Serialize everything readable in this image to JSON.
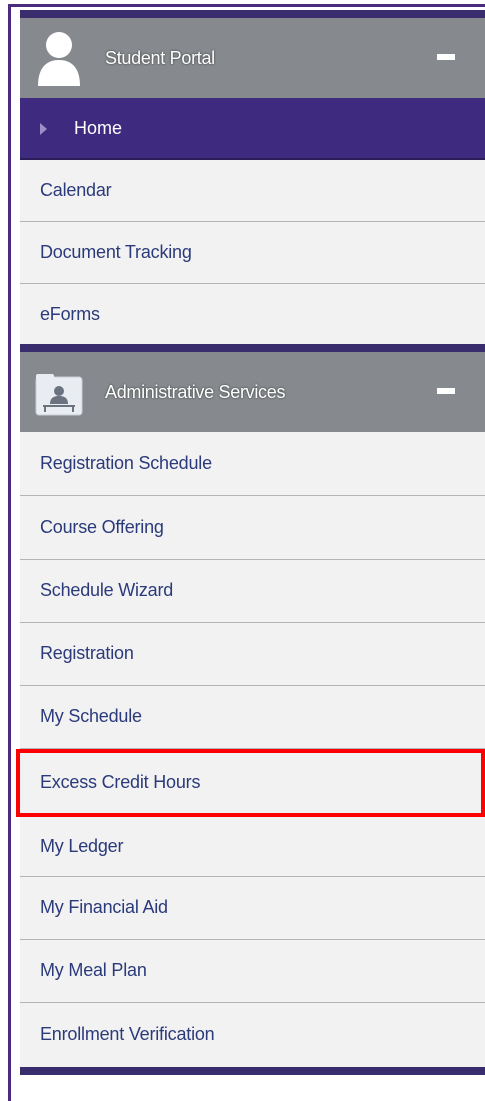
{
  "student_portal": {
    "header_title": "Student Portal",
    "collapse_symbol": "minus-icon",
    "home_label": "Home",
    "items": [
      {
        "label": "Calendar"
      },
      {
        "label": "Document Tracking"
      },
      {
        "label": "eForms"
      }
    ]
  },
  "administrative_services": {
    "header_title": "Administrative Services",
    "collapse_symbol": "minus-icon",
    "items": [
      {
        "label": "Registration Schedule"
      },
      {
        "label": "Course Offering"
      },
      {
        "label": "Schedule Wizard"
      },
      {
        "label": "Registration"
      },
      {
        "label": "My Schedule"
      },
      {
        "label": "Excess Credit Hours",
        "highlighted": true
      },
      {
        "label": "My Ledger"
      },
      {
        "label": "My Financial Aid"
      },
      {
        "label": "My Meal Plan"
      },
      {
        "label": "Enrollment Verification"
      }
    ]
  },
  "colors": {
    "header_bg": "#868a8e",
    "accent_purple": "#3e2a7e",
    "item_bg": "#f2f2f2",
    "link_text": "#2b3a7a",
    "highlight_border": "#ff0000"
  }
}
